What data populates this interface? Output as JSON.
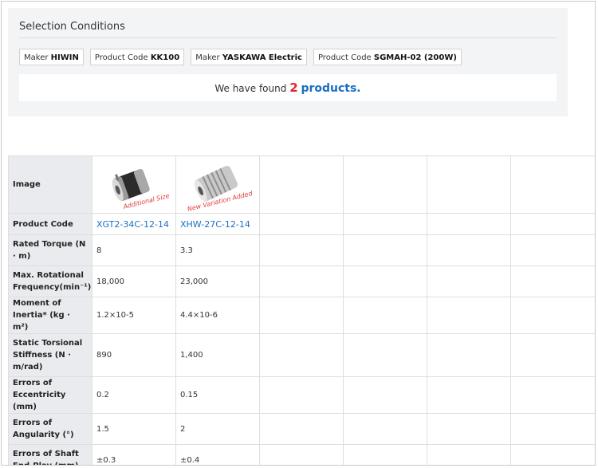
{
  "selection": {
    "title": "Selection Conditions",
    "chips": [
      {
        "key": "Maker",
        "value": "HIWIN"
      },
      {
        "key": "Product Code",
        "value": "KK100"
      },
      {
        "key": "Maker",
        "value": "YASKAWA Electric"
      },
      {
        "key": "Product Code",
        "value": "SGMAH-02 (200W)"
      }
    ],
    "found_prefix": "We have found",
    "found_count": "2",
    "found_suffix": "products."
  },
  "table": {
    "row_headers": {
      "image": "Image",
      "product_code": "Product Code",
      "rated_torque": "Rated Torque (N · m)",
      "max_rot_freq": "Max. Rotational Frequency(min⁻¹)",
      "moment_of_inertia": "Moment of Inertia* (kg · m²)",
      "static_torsional_stiffness": "Static Torsional Stiffness (N · m/rad)",
      "errors_eccentricity": "Errors of Eccentricity (mm)",
      "errors_angularity": "Errors of Angularity (°)",
      "errors_end_play": "Errors of Shaft End-Play (mm)"
    },
    "products": [
      {
        "image_icon": "coupling-clamp-black-icon",
        "image_badge": "Additional Size",
        "product_code": "XGT2-34C-12-14",
        "rated_torque": "8",
        "max_rot_freq": "18,000",
        "moment_of_inertia": "1.2×10-5",
        "static_torsional_stiffness": "890",
        "errors_eccentricity": "0.2",
        "errors_angularity": "1.5",
        "errors_end_play": "±0.3"
      },
      {
        "image_icon": "coupling-disc-silver-icon",
        "image_badge": "New Variation Added",
        "product_code": "XHW-27C-12-14",
        "rated_torque": "3.3",
        "max_rot_freq": "23,000",
        "moment_of_inertia": "4.4×10-6",
        "static_torsional_stiffness": "1,400",
        "errors_eccentricity": "0.15",
        "errors_angularity": "2",
        "errors_end_play": "±0.4"
      }
    ],
    "empty_columns": 4
  }
}
